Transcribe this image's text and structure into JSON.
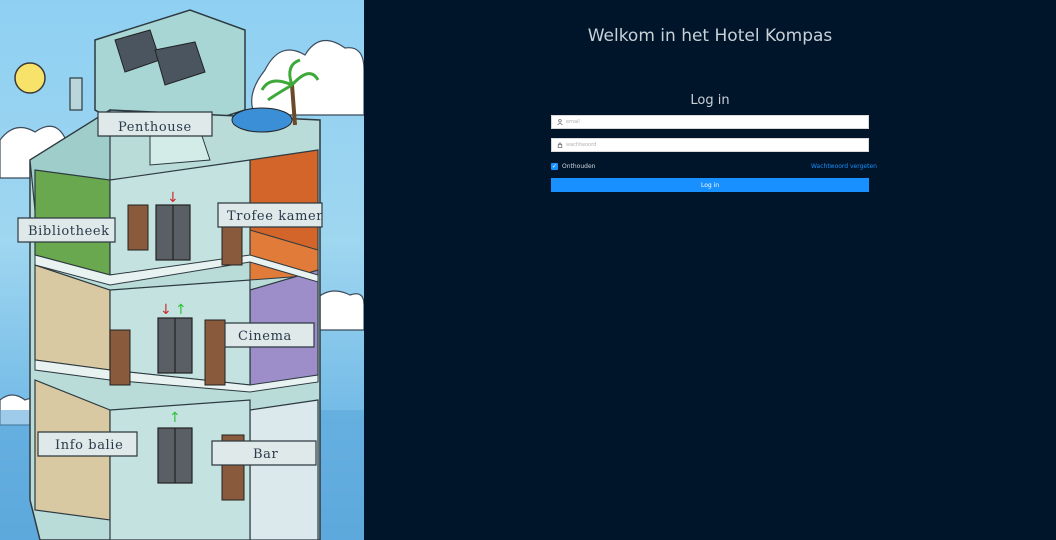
{
  "welcome_title": "Welkom in het Hotel Kompas",
  "login": {
    "heading": "Log in",
    "email_placeholder": "email",
    "password_placeholder": "wachtwoord",
    "remember_label": "Onthouden",
    "remember_checked": true,
    "forgot_link": "Wachtwoord vergeten",
    "submit_label": "Log in"
  },
  "illustration": {
    "banners": [
      "Penthouse",
      "Bibliotheek",
      "Trofee kamer",
      "Cinema",
      "Info balie",
      "Bar"
    ]
  },
  "colors": {
    "background": "#001529",
    "accent": "#1890ff",
    "sky": "#8fd0f2"
  },
  "icons": [
    "user-icon",
    "lock-icon",
    "check-icon"
  ]
}
